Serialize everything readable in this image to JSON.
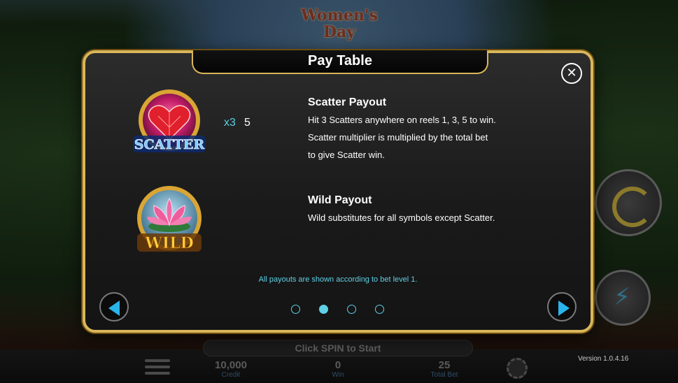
{
  "game": {
    "logo_text": "Women's Day"
  },
  "modal": {
    "title": "Pay Table",
    "close_icon": "close-icon",
    "scatter": {
      "symbol_label": "SCATTER",
      "multiplier_count": "x3",
      "multiplier_value": "5",
      "title": "Scatter Payout",
      "lines": [
        "Hit 3 Scatters anywhere on reels 1, 3, 5 to win.",
        "Scatter multiplier is multiplied by the total bet",
        "to give Scatter win."
      ]
    },
    "wild": {
      "symbol_label": "WILD",
      "title": "Wild Payout",
      "lines": [
        "Wild substitutes for all symbols except Scatter."
      ]
    },
    "note": "All payouts are shown according to bet level 1.",
    "pagination": {
      "pages": 4,
      "current": 2
    }
  },
  "bottom_bar": {
    "status": "Click SPIN to Start",
    "credit_value": "10,000",
    "credit_label": "Credit",
    "win_value": "0",
    "win_label": "Win",
    "bet_value": "25",
    "bet_label": "Total Bet",
    "version": "Version 1.0.4.16"
  },
  "colors": {
    "frame_gold": "#d9b65a",
    "accent_cyan": "#5fd0e6",
    "arrow_blue": "#2ab4ec"
  }
}
